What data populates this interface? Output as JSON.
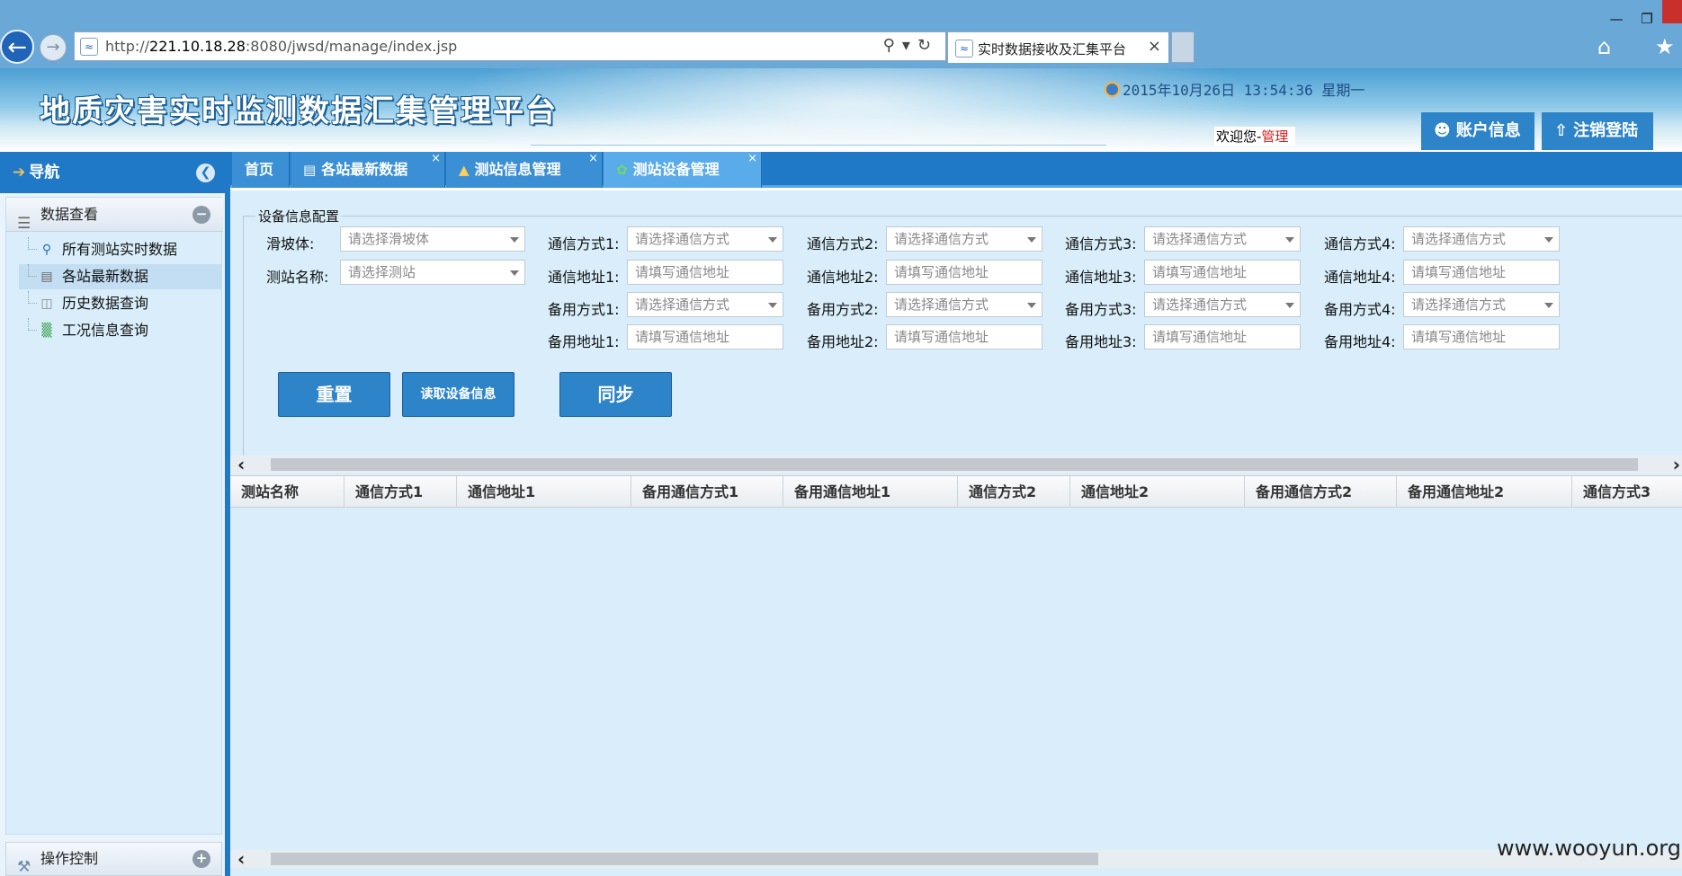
{
  "browser": {
    "url_prefix": "http://",
    "url_host": "221.10.18.28",
    "url_rest": ":8080/jwsd/manage/index.jsp",
    "tab_title": "实时数据接收及汇集平台",
    "icons": [
      "back-icon",
      "forward-icon",
      "search-icon",
      "refresh-icon",
      "home-icon",
      "favorites-star-icon"
    ]
  },
  "header": {
    "title": "地质灾害实时监测数据汇集管理平台",
    "datetime": "2015年10月26日 13:54:36 星期一",
    "welcome_prefix": "欢迎您-",
    "username": "管理",
    "account_label": "账户信息",
    "logout_label": "注销登陆"
  },
  "nav": {
    "title": "导航",
    "section1": {
      "label": "数据查看",
      "items": [
        {
          "label": "所有测站实时数据",
          "icon": "magnifier-icon"
        },
        {
          "label": "各站最新数据",
          "icon": "document-icon",
          "selected": true
        },
        {
          "label": "历史数据查询",
          "icon": "database-icon"
        },
        {
          "label": "工况信息查询",
          "icon": "sitemap-icon"
        }
      ]
    },
    "section2": {
      "label": "操作控制"
    }
  },
  "tabs": [
    {
      "label": "首页"
    },
    {
      "label": "各站最新数据",
      "closable": true
    },
    {
      "label": "测站信息管理",
      "closable": true
    },
    {
      "label": "测站设备管理",
      "closable": true,
      "active": true
    }
  ],
  "form": {
    "legend": "设备信息配置",
    "slope_label": "滑坡体:",
    "slope_placeholder": "请选择滑坡体",
    "station_label": "测站名称:",
    "station_placeholder": "请选择测站",
    "combo_placeholder": "请选择通信方式",
    "input_placeholder": "请填写通信地址",
    "comm_mode_labels": [
      "通信方式1:",
      "通信方式2:",
      "通信方式3:",
      "通信方式4:"
    ],
    "comm_addr_labels": [
      "通信地址1:",
      "通信地址2:",
      "通信地址3:",
      "通信地址4:"
    ],
    "backup_mode_labels": [
      "备用方式1:",
      "备用方式2:",
      "备用方式3:",
      "备用方式4:"
    ],
    "backup_addr_labels": [
      "备用地址1:",
      "备用地址2:",
      "备用地址3:",
      "备用地址4:"
    ],
    "buttons": {
      "reset": "重置",
      "read": "读取设备信息",
      "sync": "同步"
    }
  },
  "grid": {
    "columns": [
      "测站名称",
      "通信方式1",
      "通信地址1",
      "备用通信方式1",
      "备用通信地址1",
      "通信方式2",
      "通信地址2",
      "备用通信方式2",
      "备用通信地址2",
      "通信方式3"
    ]
  },
  "watermark": "www.wooyun.org"
}
